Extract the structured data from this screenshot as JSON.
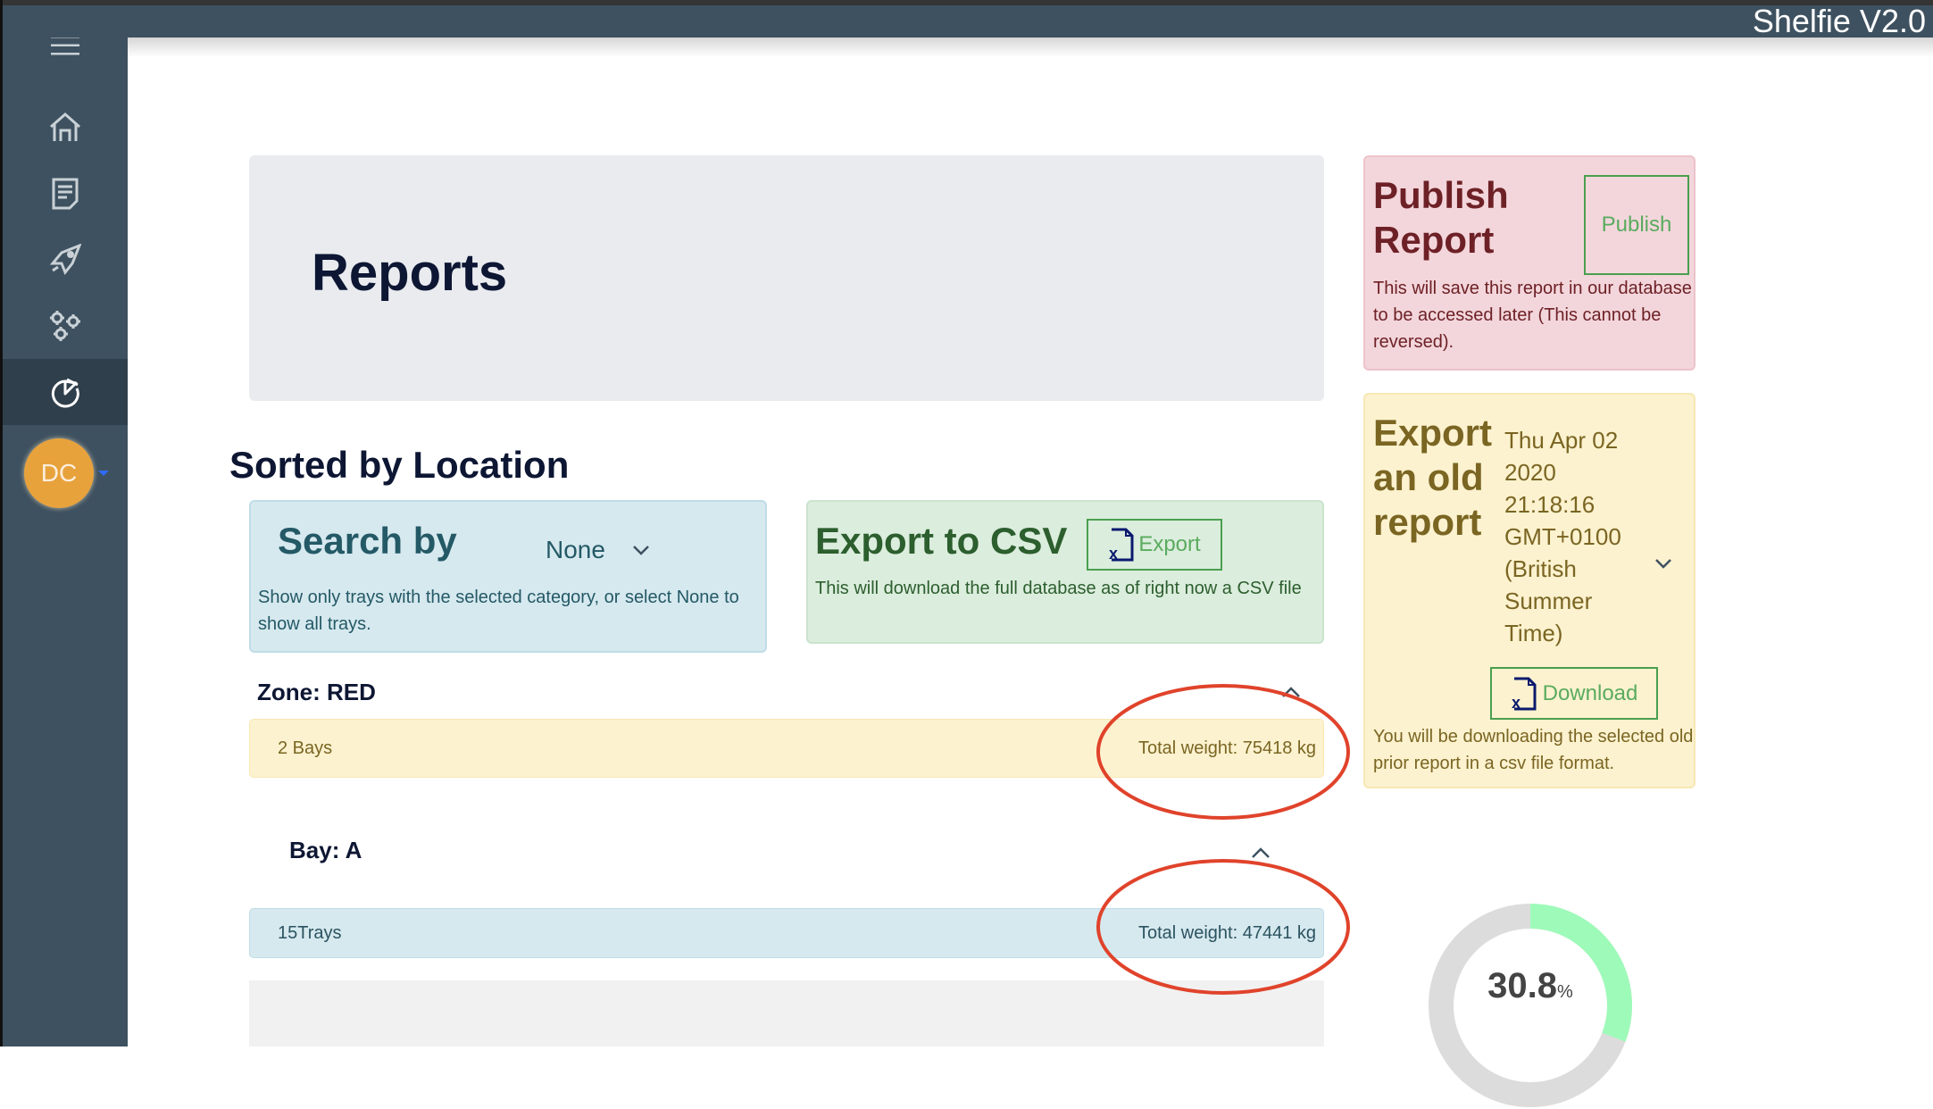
{
  "app": {
    "title": "Shelfie V2.0"
  },
  "sidebar": {
    "items": [
      {
        "name": "menu",
        "icon": "hamburger-menu-icon"
      },
      {
        "name": "home",
        "icon": "home-icon"
      },
      {
        "name": "notes",
        "icon": "document-icon"
      },
      {
        "name": "launch",
        "icon": "rocket-icon"
      },
      {
        "name": "settings",
        "icon": "gears-icon"
      },
      {
        "name": "reports",
        "icon": "pie-chart-icon",
        "active": true
      }
    ],
    "user": {
      "initials": "DC",
      "avatar_color": "#e8a23c"
    }
  },
  "header": {
    "title": "Reports"
  },
  "section": {
    "title": "Sorted by Location"
  },
  "search": {
    "title": "Search by",
    "selected": "None",
    "description": "Show only trays with the selected category, or select None to show all trays."
  },
  "export_csv": {
    "title": "Export to CSV",
    "button_label": "Export",
    "description": "This will download the full database as of right now a CSV file"
  },
  "publish": {
    "title": "Publish Report",
    "button_label": "Publish",
    "description": "This will save this report in our database to be accessed later (This cannot be reversed)."
  },
  "old_report": {
    "title": "Export an old report",
    "selected_date": "Thu Apr 02 2020 21:18:16 GMT+0100 (British Summer Time)",
    "button_label": "Download",
    "description": "You will be downloading the selected old prior report in a csv file format."
  },
  "zone": {
    "title": "Zone: RED",
    "count_label": "2 Bays",
    "weight_label": "Total weight: 75418 kg"
  },
  "bay": {
    "title": "Bay: A",
    "count_label": "15Trays",
    "weight_label": "Total weight: 47441 kg"
  },
  "gauge": {
    "value_percent": 30.8,
    "value_label": "30.8",
    "unit": "%",
    "fill_color": "#9efab9",
    "track_color": "#dcdcdc"
  },
  "annotations": {
    "circle_color": "#e0432b"
  }
}
